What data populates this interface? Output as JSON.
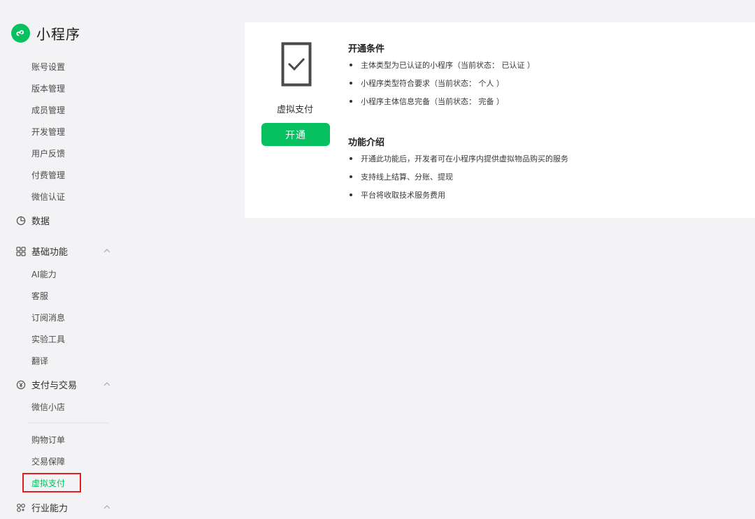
{
  "brand": {
    "title": "小程序",
    "logo_icon": "miniprogram-logo-icon",
    "accent": "#07c160"
  },
  "sidebar": {
    "account_items": [
      "账号设置",
      "版本管理",
      "成员管理",
      "开发管理",
      "用户反馈",
      "付费管理",
      "微信认证"
    ],
    "data_group": {
      "label": "数据",
      "icon": "pie-chart-icon"
    },
    "basic_group": {
      "label": "基础功能",
      "icon": "grid-icon",
      "items": [
        "AI能力",
        "客服",
        "订阅消息",
        "实验工具",
        "翻译"
      ]
    },
    "pay_group": {
      "label": "支付与交易",
      "icon": "yen-circle-icon",
      "items": [
        "微信小店",
        "购物订单",
        "交易保障",
        "虚拟支付"
      ],
      "active": "虚拟支付"
    },
    "industry_group": {
      "label": "行业能力",
      "icon": "industry-icon"
    }
  },
  "card": {
    "icon": "tablet-check-icon",
    "product_name": "虚拟支付",
    "open_button": "开通",
    "conditions": {
      "title": "开通条件",
      "items": [
        "主体类型为已认证的小程序（当前状态： 已认证 ）",
        "小程序类型符合要求（当前状态： 个人 ）",
        "小程序主体信息完备（当前状态： 完备 ）"
      ]
    },
    "intro": {
      "title": "功能介绍",
      "items": [
        "开通此功能后，开发者可在小程序内提供虚拟物品购买的服务",
        "支持线上结算、分账、提现",
        "平台将收取技术服务费用"
      ]
    }
  }
}
